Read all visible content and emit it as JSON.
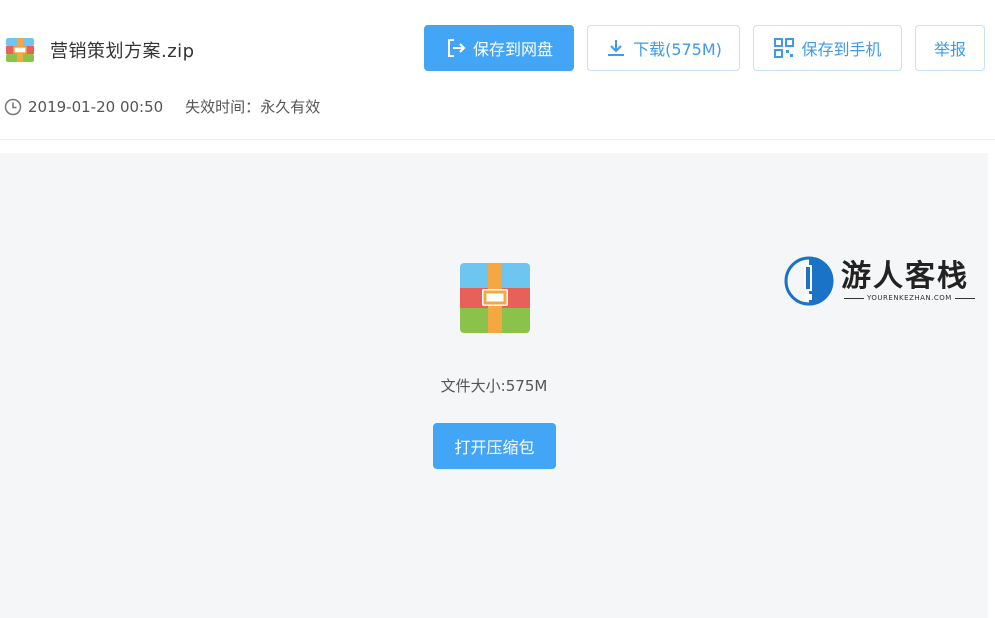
{
  "file": {
    "name": "营销策划方案.zip",
    "date": "2019-01-20 00:50",
    "expiry_label": "失效时间：",
    "expiry_value": "永久有效"
  },
  "actions": {
    "save_to_disk": "保存到网盘",
    "download": "下载(575M)",
    "save_to_phone": "保存到手机",
    "report": "举报"
  },
  "preview": {
    "size_text": "文件大小:575M",
    "open_button": "打开压缩包"
  },
  "watermark": {
    "title": "游人客栈",
    "subtitle": "YOURENKEZHAN.COM"
  },
  "colors": {
    "primary": "#42a5f5",
    "outline_text": "#3d9be9",
    "preview_bg": "#f5f6f8"
  }
}
